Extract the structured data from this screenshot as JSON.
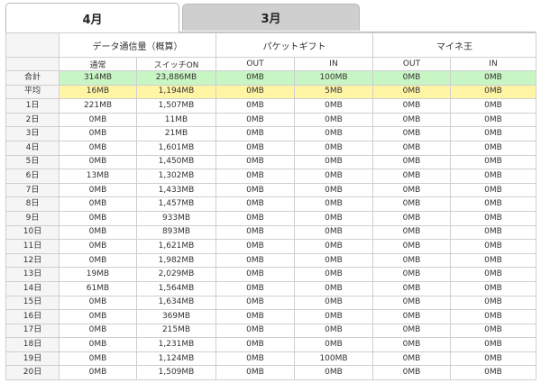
{
  "tabs": [
    {
      "label": "4月",
      "active": true
    },
    {
      "label": "3月",
      "active": false
    }
  ],
  "header": {
    "groups": [
      "データ通信量（概算）",
      "パケットギフト",
      "マイネ王"
    ],
    "subs": [
      "通常",
      "スイッチON",
      "OUT",
      "IN",
      "OUT",
      "IN"
    ]
  },
  "rows": [
    {
      "label": "合計",
      "kind": "total",
      "values": [
        "314MB",
        "23,886MB",
        "0MB",
        "100MB",
        "0MB",
        "0MB"
      ]
    },
    {
      "label": "平均",
      "kind": "avg",
      "values": [
        "16MB",
        "1,194MB",
        "0MB",
        "5MB",
        "0MB",
        "0MB"
      ]
    },
    {
      "label": "1日",
      "kind": "day",
      "values": [
        "221MB",
        "1,507MB",
        "0MB",
        "0MB",
        "0MB",
        "0MB"
      ]
    },
    {
      "label": "2日",
      "kind": "day",
      "values": [
        "0MB",
        "11MB",
        "0MB",
        "0MB",
        "0MB",
        "0MB"
      ]
    },
    {
      "label": "3日",
      "kind": "day",
      "values": [
        "0MB",
        "21MB",
        "0MB",
        "0MB",
        "0MB",
        "0MB"
      ]
    },
    {
      "label": "4日",
      "kind": "day",
      "values": [
        "0MB",
        "1,601MB",
        "0MB",
        "0MB",
        "0MB",
        "0MB"
      ]
    },
    {
      "label": "5日",
      "kind": "day",
      "values": [
        "0MB",
        "1,450MB",
        "0MB",
        "0MB",
        "0MB",
        "0MB"
      ]
    },
    {
      "label": "6日",
      "kind": "day",
      "values": [
        "13MB",
        "1,302MB",
        "0MB",
        "0MB",
        "0MB",
        "0MB"
      ]
    },
    {
      "label": "7日",
      "kind": "day",
      "values": [
        "0MB",
        "1,433MB",
        "0MB",
        "0MB",
        "0MB",
        "0MB"
      ]
    },
    {
      "label": "8日",
      "kind": "day",
      "values": [
        "0MB",
        "1,457MB",
        "0MB",
        "0MB",
        "0MB",
        "0MB"
      ]
    },
    {
      "label": "9日",
      "kind": "day",
      "values": [
        "0MB",
        "933MB",
        "0MB",
        "0MB",
        "0MB",
        "0MB"
      ]
    },
    {
      "label": "10日",
      "kind": "day",
      "values": [
        "0MB",
        "893MB",
        "0MB",
        "0MB",
        "0MB",
        "0MB"
      ]
    },
    {
      "label": "11日",
      "kind": "day",
      "values": [
        "0MB",
        "1,621MB",
        "0MB",
        "0MB",
        "0MB",
        "0MB"
      ]
    },
    {
      "label": "12日",
      "kind": "day",
      "values": [
        "0MB",
        "1,982MB",
        "0MB",
        "0MB",
        "0MB",
        "0MB"
      ]
    },
    {
      "label": "13日",
      "kind": "day",
      "values": [
        "19MB",
        "2,029MB",
        "0MB",
        "0MB",
        "0MB",
        "0MB"
      ]
    },
    {
      "label": "14日",
      "kind": "day",
      "values": [
        "61MB",
        "1,564MB",
        "0MB",
        "0MB",
        "0MB",
        "0MB"
      ]
    },
    {
      "label": "15日",
      "kind": "day",
      "values": [
        "0MB",
        "1,634MB",
        "0MB",
        "0MB",
        "0MB",
        "0MB"
      ]
    },
    {
      "label": "16日",
      "kind": "day",
      "values": [
        "0MB",
        "369MB",
        "0MB",
        "0MB",
        "0MB",
        "0MB"
      ]
    },
    {
      "label": "17日",
      "kind": "day",
      "values": [
        "0MB",
        "215MB",
        "0MB",
        "0MB",
        "0MB",
        "0MB"
      ]
    },
    {
      "label": "18日",
      "kind": "day",
      "values": [
        "0MB",
        "1,231MB",
        "0MB",
        "0MB",
        "0MB",
        "0MB"
      ]
    },
    {
      "label": "19日",
      "kind": "day",
      "values": [
        "0MB",
        "1,124MB",
        "0MB",
        "100MB",
        "0MB",
        "0MB"
      ]
    },
    {
      "label": "20日",
      "kind": "day",
      "values": [
        "0MB",
        "1,509MB",
        "0MB",
        "0MB",
        "0MB",
        "0MB"
      ]
    }
  ],
  "colors": {
    "total_row": "#c8f5c4",
    "avg_row": "#fff5a5",
    "inactive_tab": "#cfcfcf",
    "grid": "#cfcfcf"
  }
}
